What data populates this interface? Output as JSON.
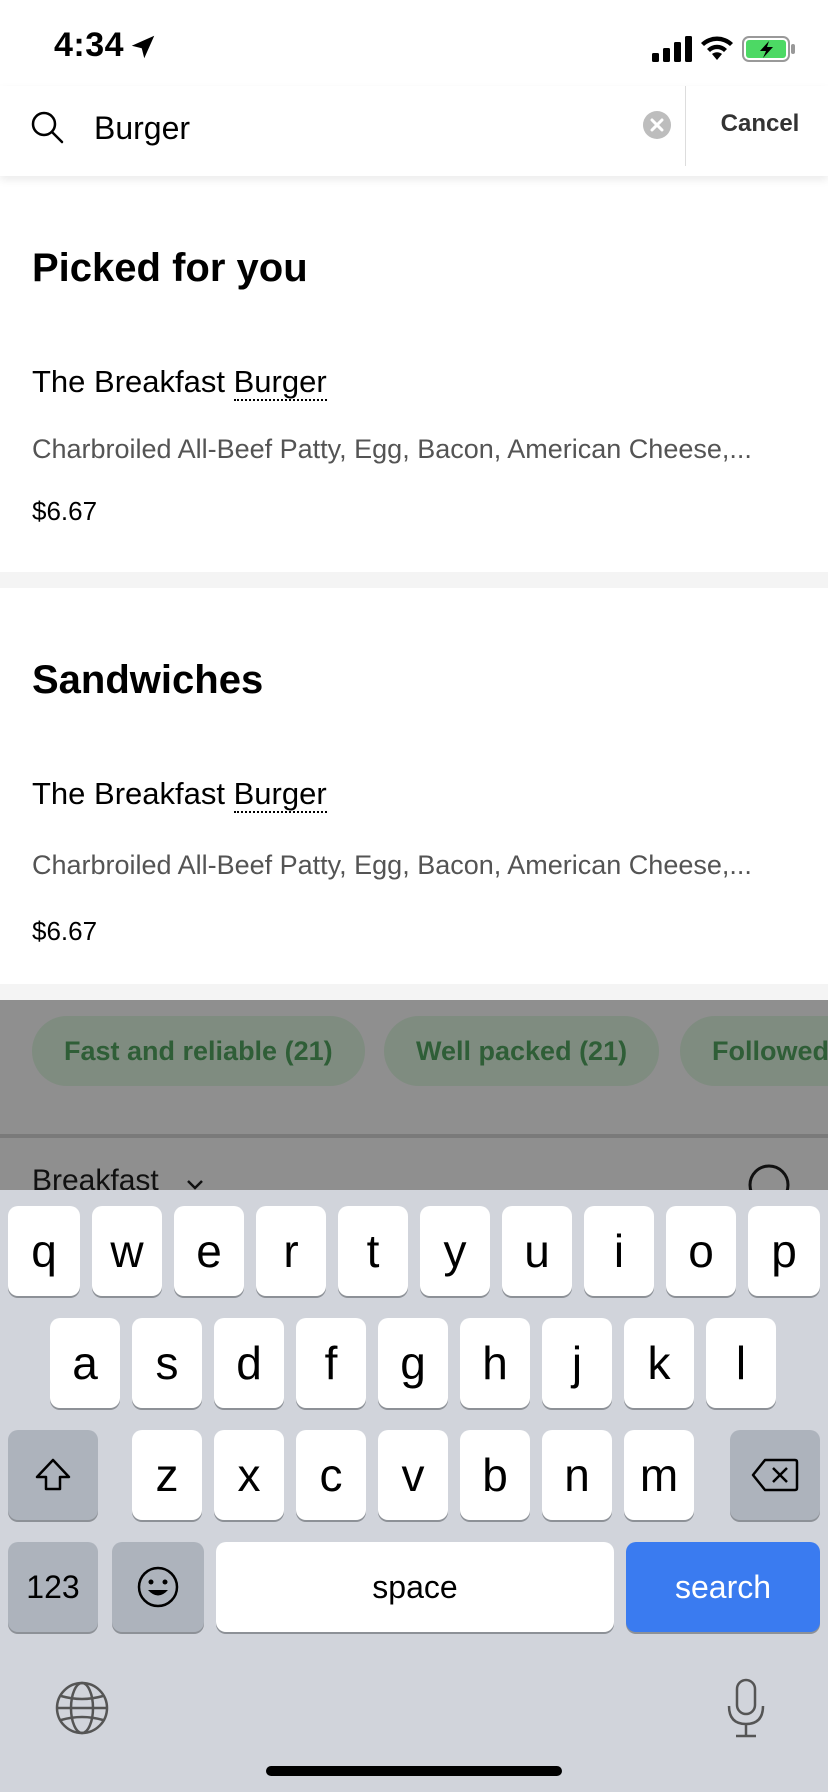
{
  "status_bar": {
    "time": "4:34"
  },
  "search": {
    "query": "Burger",
    "placeholder": "",
    "cancel_label": "Cancel"
  },
  "sections": [
    {
      "title": "Picked for you",
      "item": {
        "name_prefix": "The Breakfast ",
        "name_match": "Burger",
        "description": "Charbroiled All-Beef Patty, Egg, Bacon, American Cheese,...",
        "price": "$6.67"
      }
    },
    {
      "title": "Sandwiches",
      "item": {
        "name_prefix": "The Breakfast ",
        "name_match": "Burger",
        "description": "Charbroiled All-Beef Patty, Egg, Bacon, American Cheese,...",
        "price": "$6.67"
      }
    }
  ],
  "chips": [
    "Fast and reliable (21)",
    "Well packed (21)",
    "Followed"
  ],
  "menu_tab": {
    "label": "Breakfast"
  },
  "keyboard": {
    "row1": [
      "q",
      "w",
      "e",
      "r",
      "t",
      "y",
      "u",
      "i",
      "o",
      "p"
    ],
    "row2": [
      "a",
      "s",
      "d",
      "f",
      "g",
      "h",
      "j",
      "k",
      "l"
    ],
    "row3": [
      "z",
      "x",
      "c",
      "v",
      "b",
      "n",
      "m"
    ],
    "numbers_label": "123",
    "space_label": "space",
    "search_label": "search"
  },
  "colors": {
    "accent_blue": "#3a7bf0",
    "chip_text": "#2f5e37",
    "keyboard_bg": "#d1d4db"
  },
  "icons": [
    "location-arrow-icon",
    "signal-icon",
    "wifi-icon",
    "battery-icon",
    "search-icon",
    "clear-icon",
    "chevron-down-icon",
    "shift-icon",
    "backspace-icon",
    "emoji-icon",
    "globe-icon",
    "microphone-icon"
  ]
}
